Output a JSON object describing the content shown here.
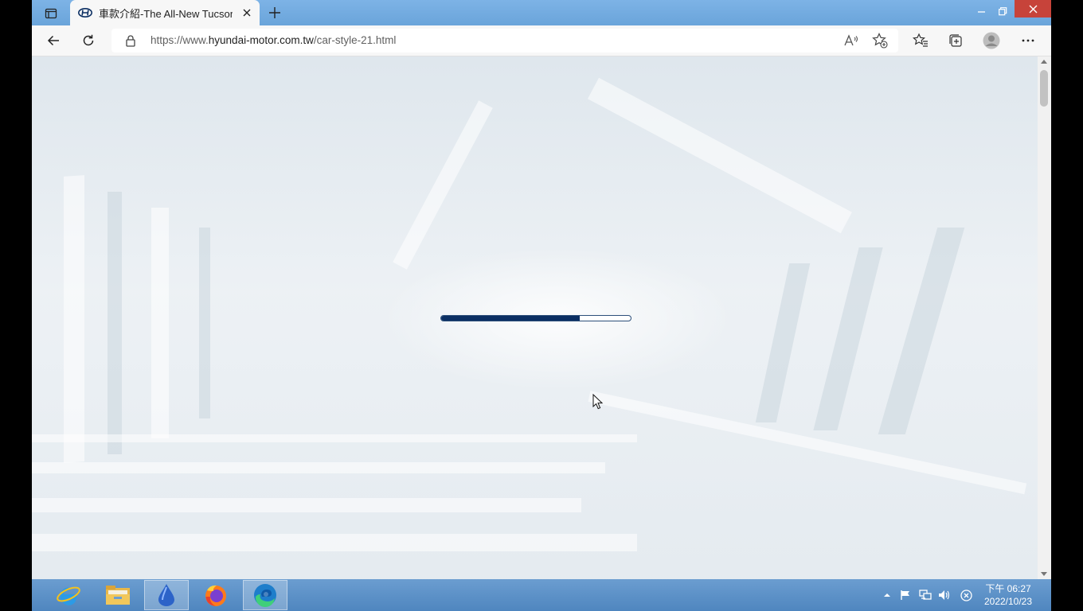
{
  "browser": {
    "tab": {
      "title": "車款介紹-The All-New Tucson L",
      "favicon": "hyundai-logo-icon"
    },
    "address": {
      "url_prefix": "https://www.",
      "url_domain": "hyundai-motor.com.tw",
      "url_path": "/car-style-21.html"
    },
    "window_controls": [
      "minimize",
      "restore",
      "close"
    ],
    "colors": {
      "titlebar": "#6fa8dc",
      "close": "#c7433a"
    }
  },
  "page": {
    "loading_progress": 0.73,
    "progress_color": "#0b2f63"
  },
  "taskbar": {
    "apps": [
      {
        "name": "Internet Explorer",
        "icon": "ie-icon",
        "active": false
      },
      {
        "name": "File Explorer",
        "icon": "folder-icon",
        "active": false
      },
      {
        "name": "App",
        "icon": "drop-app-icon",
        "active": true
      },
      {
        "name": "Firefox",
        "icon": "firefox-icon",
        "active": false
      },
      {
        "name": "Microsoft Edge",
        "icon": "edge-icon",
        "active": true
      }
    ],
    "clock": {
      "time": "下午 06:27",
      "date": "2022/10/23"
    }
  }
}
